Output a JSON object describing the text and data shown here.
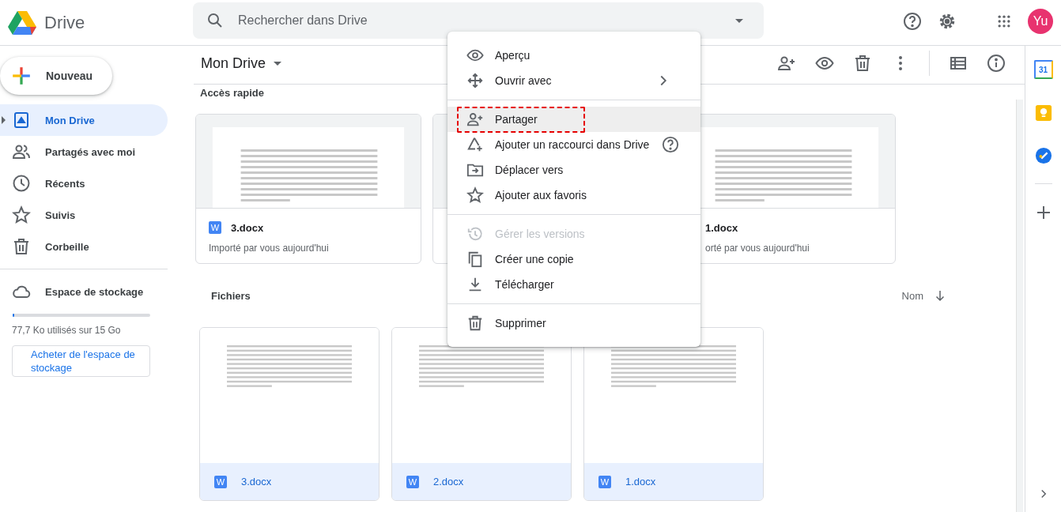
{
  "app": {
    "name": "Drive"
  },
  "search": {
    "placeholder": "Rechercher dans Drive"
  },
  "account": {
    "initials": "Yu"
  },
  "new_button": {
    "label": "Nouveau"
  },
  "sidebar": {
    "items": [
      {
        "label": "Mon Drive",
        "selected": true
      },
      {
        "label": "Partagés avec moi",
        "selected": false
      },
      {
        "label": "Récents",
        "selected": false
      },
      {
        "label": "Suivis",
        "selected": false
      },
      {
        "label": "Corbeille",
        "selected": false
      }
    ],
    "storage": {
      "label": "Espace de stockage",
      "level": 0.01,
      "usage": "77,7 Ko utilisés sur 15 Go",
      "buy_button": "Acheter de l'espace de stockage"
    }
  },
  "toolbar": {
    "title": "Mon Drive"
  },
  "quick_access": {
    "title": "Accès rapide",
    "cards": [
      {
        "kind": "full",
        "badge": "W",
        "name": "3.docx",
        "subtitle": "Importé par vous aujourd'hui"
      },
      {
        "kind": "hidden"
      },
      {
        "kind": "partial",
        "name": "1.docx",
        "subtitle": "orté par vous aujourd'hui"
      }
    ]
  },
  "files": {
    "title": "Fichiers",
    "sort": "Nom",
    "cards": [
      {
        "badge": "W",
        "name": "3.docx"
      },
      {
        "badge": "W",
        "name": "2.docx"
      },
      {
        "badge": "W",
        "name": "1.docx"
      }
    ]
  },
  "context_menu": {
    "items": [
      {
        "kind": "item",
        "label": "Aperçu",
        "disabled": false,
        "highlighted": false,
        "marked": false,
        "submenu": false,
        "help": false
      },
      {
        "kind": "item",
        "label": "Ouvrir avec",
        "disabled": false,
        "highlighted": false,
        "marked": false,
        "submenu": true,
        "help": false
      },
      {
        "kind": "separator"
      },
      {
        "kind": "item",
        "label": "Partager",
        "disabled": false,
        "highlighted": true,
        "marked": true,
        "submenu": false,
        "help": false
      },
      {
        "kind": "item",
        "label": "Ajouter un raccourci dans Drive",
        "disabled": false,
        "highlighted": false,
        "marked": false,
        "submenu": false,
        "help": true
      },
      {
        "kind": "item",
        "label": "Déplacer vers",
        "disabled": false,
        "highlighted": false,
        "marked": false,
        "submenu": false,
        "help": false
      },
      {
        "kind": "item",
        "label": "Ajouter aux favoris",
        "disabled": false,
        "highlighted": false,
        "marked": false,
        "submenu": false,
        "help": false
      },
      {
        "kind": "separator"
      },
      {
        "kind": "item",
        "label": "Gérer les versions",
        "disabled": true,
        "highlighted": false,
        "marked": false,
        "submenu": false,
        "help": false
      },
      {
        "kind": "item",
        "label": "Créer une copie",
        "disabled": false,
        "highlighted": false,
        "marked": false,
        "submenu": false,
        "help": false
      },
      {
        "kind": "item",
        "label": "Télécharger",
        "disabled": false,
        "highlighted": false,
        "marked": false,
        "submenu": false,
        "help": false
      },
      {
        "kind": "separator"
      },
      {
        "kind": "item",
        "label": "Supprimer",
        "disabled": false,
        "highlighted": false,
        "marked": false,
        "submenu": false,
        "help": false
      }
    ]
  },
  "side_panel": {
    "calendar_day": "31"
  }
}
